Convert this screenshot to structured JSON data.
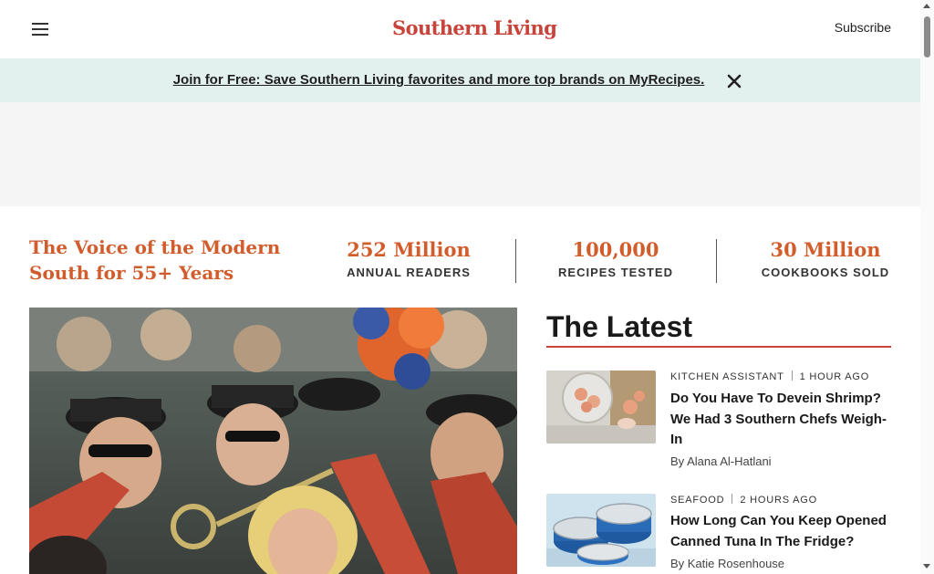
{
  "header": {
    "logo_text": "Southern Living",
    "subscribe_label": "Subscribe",
    "menu_icon": "hamburger-menu-icon"
  },
  "banner": {
    "link_text": "Join for Free: Save Southern Living favorites and more top brands on MyRecipes.",
    "close_icon": "close-icon",
    "background": "#e2f0ee"
  },
  "stats": {
    "tagline": "The Voice of the Modern South for 55+ Years",
    "items": [
      {
        "value": "252 Million",
        "label": "ANNUAL READERS"
      },
      {
        "value": "100,000",
        "label": "RECIPES TESTED"
      },
      {
        "value": "30 Million",
        "label": "COOKBOOKS SOLD"
      }
    ]
  },
  "latest": {
    "heading": "The Latest",
    "articles": [
      {
        "category": "KITCHEN ASSISTANT",
        "time": "1 HOUR AGO",
        "headline": "Do You Have To Devein Shrimp? We Had 3 Southern Chefs Weigh-In",
        "byline": "By Alana Al-Hatlani"
      },
      {
        "category": "SEAFOOD",
        "time": "2 HOURS AGO",
        "headline": "How Long Can You Keep Opened Canned Tuna In The Fridge?",
        "byline": "By Katie Rosenhouse"
      }
    ]
  },
  "colors": {
    "brand_red": "#c8443a",
    "accent_orange": "#d25d2c"
  }
}
